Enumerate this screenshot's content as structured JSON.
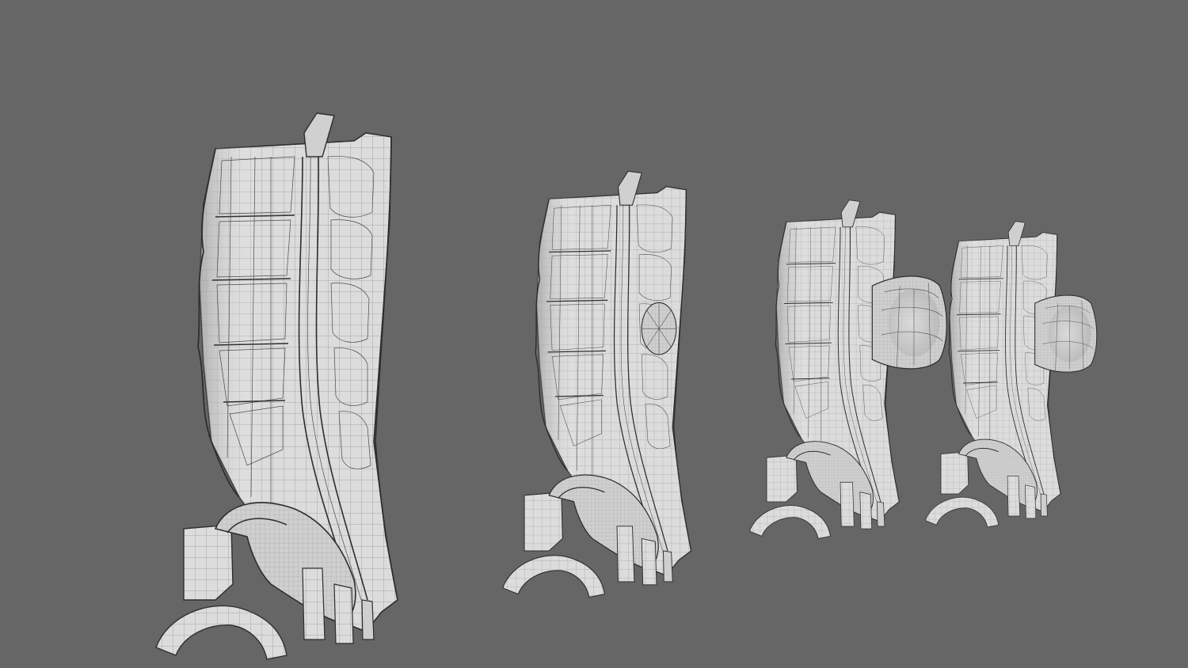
{
  "scene": {
    "background_color": "#666666",
    "mesh_color": "#dcdcdc",
    "mesh_shade_color": "#b9b9b9",
    "wire_color": "#4a4a4a",
    "models": [
      {
        "name": "spine-model-normal",
        "stage": "normal",
        "has_cyst": false,
        "cyst_size": 0
      },
      {
        "name": "spine-model-small-cyst",
        "stage": "small-cyst",
        "has_cyst": true,
        "cyst_size": 0.25
      },
      {
        "name": "spine-model-large-cyst",
        "stage": "large-cyst",
        "has_cyst": true,
        "cyst_size": 0.8
      },
      {
        "name": "spine-model-large-cyst-2",
        "stage": "large-cyst",
        "has_cyst": true,
        "cyst_size": 0.75
      }
    ]
  }
}
